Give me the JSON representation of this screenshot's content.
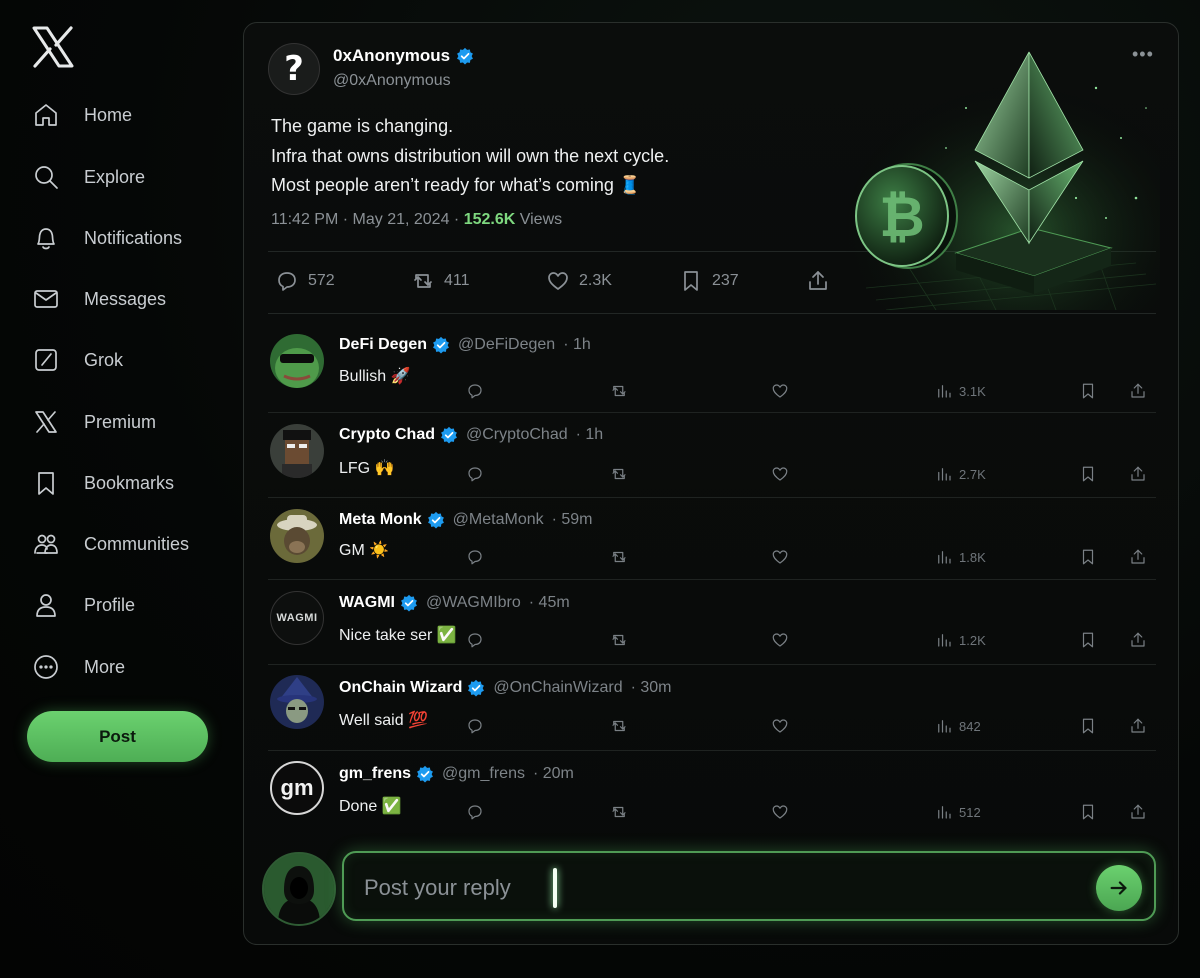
{
  "sidebar": {
    "logo_icon": "x-logo-icon",
    "items": [
      {
        "label": "Home",
        "icon": "home-icon"
      },
      {
        "label": "Explore",
        "icon": "search-icon"
      },
      {
        "label": "Notifications",
        "icon": "bell-icon"
      },
      {
        "label": "Messages",
        "icon": "envelope-icon"
      },
      {
        "label": "Grok",
        "icon": "grok-icon"
      },
      {
        "label": "Premium",
        "icon": "x-icon"
      },
      {
        "label": "Bookmarks",
        "icon": "bookmark-icon"
      },
      {
        "label": "Communities",
        "icon": "people-icon"
      },
      {
        "label": "Profile",
        "icon": "person-icon"
      },
      {
        "label": "More",
        "icon": "more-circle-icon"
      }
    ],
    "post_label": "Post"
  },
  "tweet": {
    "avatar_glyph": "?",
    "author_name": "0xAnonymous",
    "author_handle": "@0xAnonymous",
    "lines": [
      "The game is changing.",
      "Infra that owns distribution will own the next cycle.",
      "Most people aren’t ready for what’s coming 🧵"
    ],
    "time": "11:42 PM · May 21, 2024 · ",
    "views_count": "152.6K",
    "views_label": " Views",
    "replies": "572",
    "reposts": "411",
    "likes": "2.3K",
    "bookmarks": "237"
  },
  "replies": [
    {
      "name": "DeFi Degen",
      "handle": "@DeFiDegen",
      "time": "· 1h",
      "text": "Bullish 🚀",
      "views": "3.1K"
    },
    {
      "name": "Crypto Chad",
      "handle": "@CryptoChad",
      "time": "· 1h",
      "text": "LFG 🙌",
      "views": "2.7K"
    },
    {
      "name": "Meta Monk",
      "handle": "@MetaMonk",
      "time": "· 59m",
      "text": "GM ☀️",
      "views": "1.8K"
    },
    {
      "name": "WAGMI",
      "handle": "@WAGMIbro",
      "time": "· 45m",
      "text": "Nice take ser ✅",
      "views": "1.2K",
      "avatar_text": "WAGMI"
    },
    {
      "name": "OnChain Wizard",
      "handle": "@OnChainWizard",
      "time": "· 30m",
      "text": "Well said 💯",
      "views": "842"
    },
    {
      "name": "gm_frens",
      "handle": "@gm_frens",
      "time": "· 20m",
      "text": "Done ✅",
      "views": "512",
      "avatar_text": "gm"
    }
  ],
  "composer": {
    "placeholder": "Post your reply"
  },
  "colors": {
    "accent": "#5bc462",
    "verified": "#1d9bf0",
    "background": "#050706"
  }
}
